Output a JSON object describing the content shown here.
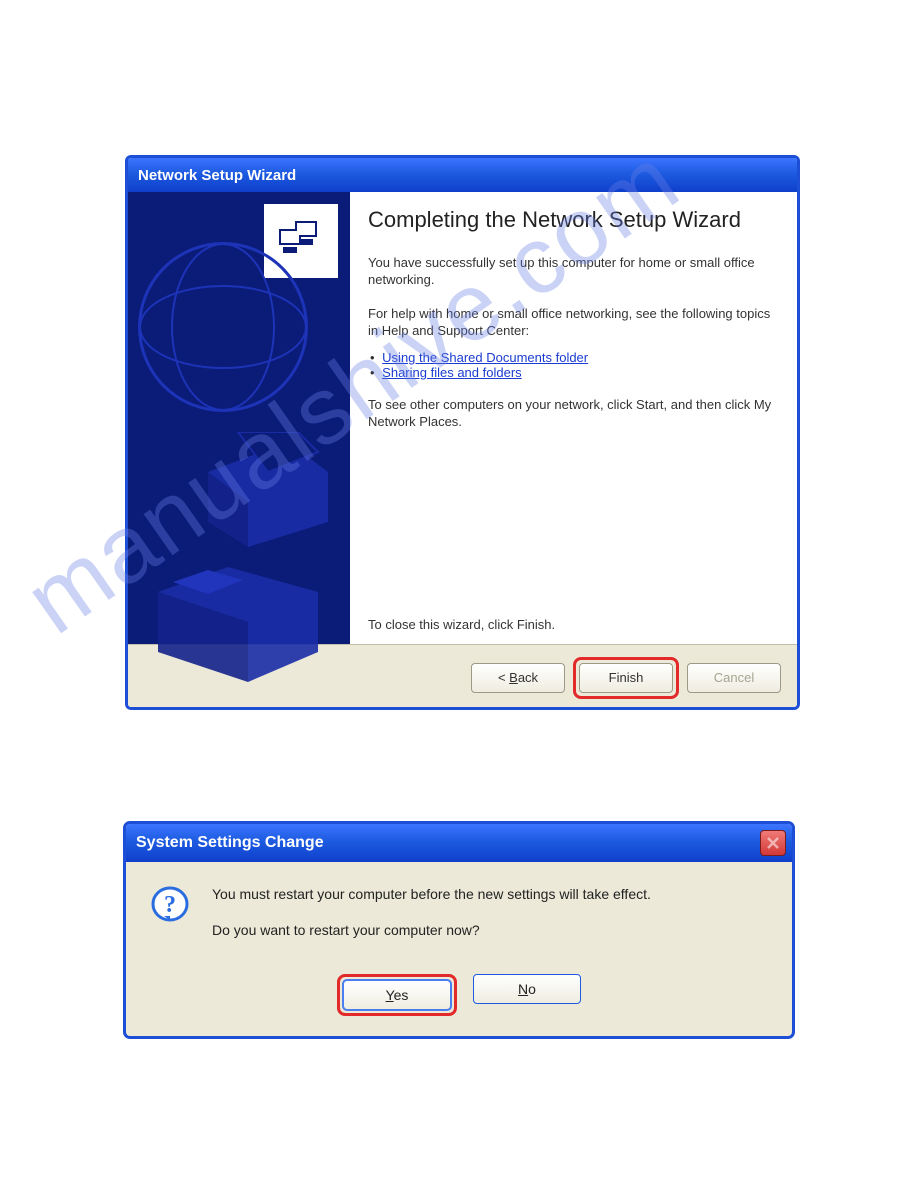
{
  "watermark": "manualshive.com",
  "wizard": {
    "title": "Network Setup Wizard",
    "heading": "Completing the Network Setup Wizard",
    "p1": "You have successfully set up this computer for home or small office networking.",
    "p2": "For help with home or small office networking, see the following topics in Help and Support Center:",
    "links": {
      "l1": "Using the Shared Documents folder",
      "l2": "Sharing files and folders"
    },
    "p3": "To see other computers on your network, click Start, and then click My Network Places.",
    "close_hint": "To close this wizard, click Finish.",
    "buttons": {
      "back_prefix": "< ",
      "back_ul": "B",
      "back_suffix": "ack",
      "finish": "Finish",
      "cancel": "Cancel"
    }
  },
  "sysdlg": {
    "title": "System Settings Change",
    "msg1": "You must restart your computer before the new settings will take effect.",
    "msg2": "Do you want to restart your computer now?",
    "buttons": {
      "yes_ul": "Y",
      "yes_suffix": "es",
      "no_ul": "N",
      "no_suffix": "o"
    }
  }
}
